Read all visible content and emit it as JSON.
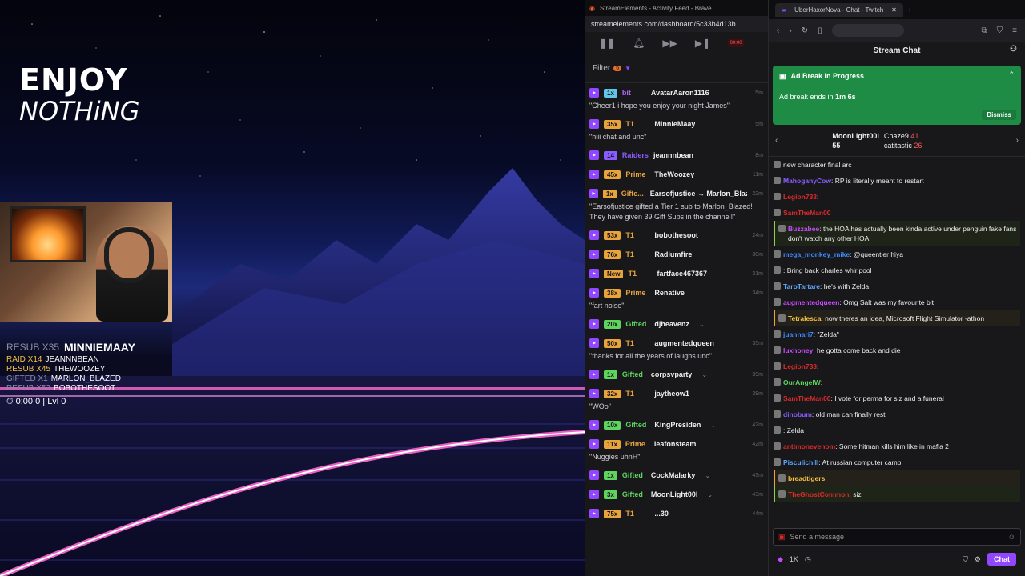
{
  "scene": {
    "logo_line1": "ENJOY",
    "logo_line2": "NOTHiNG",
    "ticker": {
      "first_tag": "RESUB X35",
      "first_name": "MINNIEMAAY",
      "rows": [
        {
          "kind": "RAID X14",
          "name": "JEANNNBEAN",
          "dim": false
        },
        {
          "kind": "RESUB X45",
          "name": "THEWOOZEY",
          "dim": false
        },
        {
          "kind": "GIFTED X1",
          "name": "MARLON_BLAZED",
          "dim": true
        },
        {
          "kind": "RESUB X53",
          "name": "BOBOTHESOOT",
          "dim": true
        }
      ],
      "stats": "⏱ 0:00   0 | Lvl 0"
    }
  },
  "feed": {
    "window_title": "StreamElements - Activity Feed - Brave",
    "url": "streamelements.com/dashboard/5c33b4d13b...",
    "filter_label": "Filter",
    "filter_count": "6",
    "items": [
      {
        "badge": "1x",
        "badge_color": "#5fc8e8",
        "type": "bit",
        "type_color": "#b36bff",
        "user": "AvatarAaron1116",
        "time": "5m",
        "msg": "\"Cheer1 i hope you enjoy your night James\""
      },
      {
        "badge": "35x",
        "badge_color": "#e8a33d",
        "type": "T1",
        "type_color": "#e8a33d",
        "user": "MinnieMaay",
        "time": "5m",
        "msg": "\"hiii chat and unc\""
      },
      {
        "badge": "14",
        "badge_color": "#8a5cff",
        "type": "Raiders",
        "type_color": "#8a5cff",
        "user": "jeannnbean",
        "time": "8m",
        "msg": ""
      },
      {
        "badge": "45x",
        "badge_color": "#e8a33d",
        "type": "Prime",
        "type_color": "#e8a33d",
        "user": "TheWoozey",
        "time": "11m",
        "msg": ""
      },
      {
        "badge": "1x",
        "badge_color": "#e8a33d",
        "type": "Gifte...",
        "type_color": "#e8a33d",
        "user": "Earsofjustice → Marlon_Blazed",
        "time": "22m",
        "msg": "\"Earsofjustice gifted a Tier 1 sub to Marlon_Blazed! They have given 39 Gift Subs in the channel!\""
      },
      {
        "badge": "53x",
        "badge_color": "#e8a33d",
        "type": "T1",
        "type_color": "#e8a33d",
        "user": "bobothesoot",
        "time": "24m",
        "msg": ""
      },
      {
        "badge": "76x",
        "badge_color": "#e8a33d",
        "type": "T1",
        "type_color": "#e8a33d",
        "user": "Radiumfire",
        "time": "30m",
        "msg": ""
      },
      {
        "badge": "New",
        "badge_color": "#e8a33d",
        "type": "T1",
        "type_color": "#e8a33d",
        "user": "fartface467367",
        "time": "31m",
        "msg": ""
      },
      {
        "badge": "38x",
        "badge_color": "#e8a33d",
        "type": "Prime",
        "type_color": "#e8a33d",
        "user": "Renative",
        "time": "34m",
        "msg": "\"fart noise\""
      },
      {
        "badge": "20x",
        "badge_color": "#5ed35e",
        "type": "Gifted",
        "type_color": "#5ed35e",
        "user": "djheavenz",
        "time": "",
        "msg": "",
        "caret": true
      },
      {
        "badge": "50x",
        "badge_color": "#e8a33d",
        "type": "T1",
        "type_color": "#e8a33d",
        "user": "augmentedqueen",
        "time": "35m",
        "msg": "\"thanks for all the years of laughs unc\""
      },
      {
        "badge": "1x",
        "badge_color": "#5ed35e",
        "type": "Gifted",
        "type_color": "#5ed35e",
        "user": "corpsvparty",
        "time": "39m",
        "msg": "",
        "caret": true
      },
      {
        "badge": "32x",
        "badge_color": "#e8a33d",
        "type": "T1",
        "type_color": "#e8a33d",
        "user": "jaytheow1",
        "time": "39m",
        "msg": "\"WOo\""
      },
      {
        "badge": "10x",
        "badge_color": "#5ed35e",
        "type": "Gifted",
        "type_color": "#5ed35e",
        "user": "KingPresiden",
        "time": "42m",
        "msg": "",
        "caret": true
      },
      {
        "badge": "11x",
        "badge_color": "#e8a33d",
        "type": "Prime",
        "type_color": "#e8a33d",
        "user": "leafonsteam",
        "time": "42m",
        "msg": "\"Nuggies uhnH\""
      },
      {
        "badge": "1x",
        "badge_color": "#5ed35e",
        "type": "Gifted",
        "type_color": "#5ed35e",
        "user": "CockMalarky",
        "time": "43m",
        "msg": "",
        "caret": true
      },
      {
        "badge": "3x",
        "badge_color": "#5ed35e",
        "type": "Gifted",
        "type_color": "#5ed35e",
        "user": "MoonLight00l",
        "time": "43m",
        "msg": "",
        "caret": true
      },
      {
        "badge": "75x",
        "badge_color": "#e8a33d",
        "type": "T1",
        "type_color": "#e8a33d",
        "user": "...30",
        "time": "44m",
        "msg": ""
      }
    ]
  },
  "chat": {
    "tab_title": "UberHaxorNova - Chat - Twitch",
    "header": "Stream Chat",
    "ad_title": "Ad Break In Progress",
    "ad_text": "Ad break ends in",
    "ad_time": "1m 6s",
    "dismiss": "Dismiss",
    "leaders": {
      "first": "MoonLight00l",
      "first_count": "55",
      "second": "Chaze9",
      "second_count": "41",
      "third": "catitastic",
      "third_count": "26"
    },
    "messages": [
      {
        "user": "",
        "color": "#9147ff",
        "text": "new character final arc",
        "style": ""
      },
      {
        "user": "MahoganyCow",
        "color": "#8a5cff",
        "text": ": RP is literally meant to restart",
        "style": ""
      },
      {
        "user": "Legion733",
        "color": "#e02a2a",
        "text": ":",
        "style": ""
      },
      {
        "user": "SamTheMan00",
        "color": "#e02a2a",
        "text": "",
        "style": ""
      },
      {
        "user": "Buzzabee",
        "color": "#c94bff",
        "text": ": the HOA has actually been kinda active under penguin fake fans don't watch any other HOA",
        "style": "raid"
      },
      {
        "user": "mega_monkey_mike",
        "color": "#3f8bff",
        "text": ": @queentier hiya",
        "style": ""
      },
      {
        "user": "",
        "color": "#aaa",
        "text": ": Bring back charles whirlpool",
        "style": ""
      },
      {
        "user": "TaroTartare",
        "color": "#5fa8ff",
        "text": ": he's with Zelda",
        "style": ""
      },
      {
        "user": "augmentedqueen",
        "color": "#c94bff",
        "text": ": Omg Salt was my favourite bit",
        "style": ""
      },
      {
        "user": "Tetralesca",
        "color": "#f4c542",
        "text": ": now theres an idea, Microsoft Flight Simulator -athon",
        "style": "hl"
      },
      {
        "user": "juannari7",
        "color": "#3f8bff",
        "text": ": \"Zelda\"",
        "style": ""
      },
      {
        "user": "luxhoney",
        "color": "#c94bff",
        "text": ": he gotta come back and die",
        "style": ""
      },
      {
        "user": "Legion733",
        "color": "#e02a2a",
        "text": ":",
        "style": ""
      },
      {
        "user": "OurAngelW",
        "color": "#5ed35e",
        "text": ":",
        "style": ""
      },
      {
        "user": "SamTheMan00",
        "color": "#e02a2a",
        "text": ": I vote for perma for siz and a funeral",
        "style": ""
      },
      {
        "user": "dinobum",
        "color": "#8a5cff",
        "text": ": old man can finally rest",
        "style": ""
      },
      {
        "user": "",
        "color": "#3f8bff",
        "text": ": Zelda",
        "style": ""
      },
      {
        "user": "antimonevenom",
        "color": "#e02a2a",
        "text": ": Some hitman kills him like in mafia 2",
        "style": ""
      },
      {
        "user": "Pisculichill",
        "color": "#5fa8ff",
        "text": ": At russian computer camp",
        "style": ""
      },
      {
        "user": "breadtigers",
        "color": "#f4c542",
        "text": ":",
        "style": "hl"
      },
      {
        "user": "TheGhostCommon",
        "color": "#e02a2a",
        "text": ": siz",
        "style": "raid"
      }
    ],
    "input_placeholder": "Send a message",
    "bits_count": "1K",
    "chat_button": "Chat"
  }
}
